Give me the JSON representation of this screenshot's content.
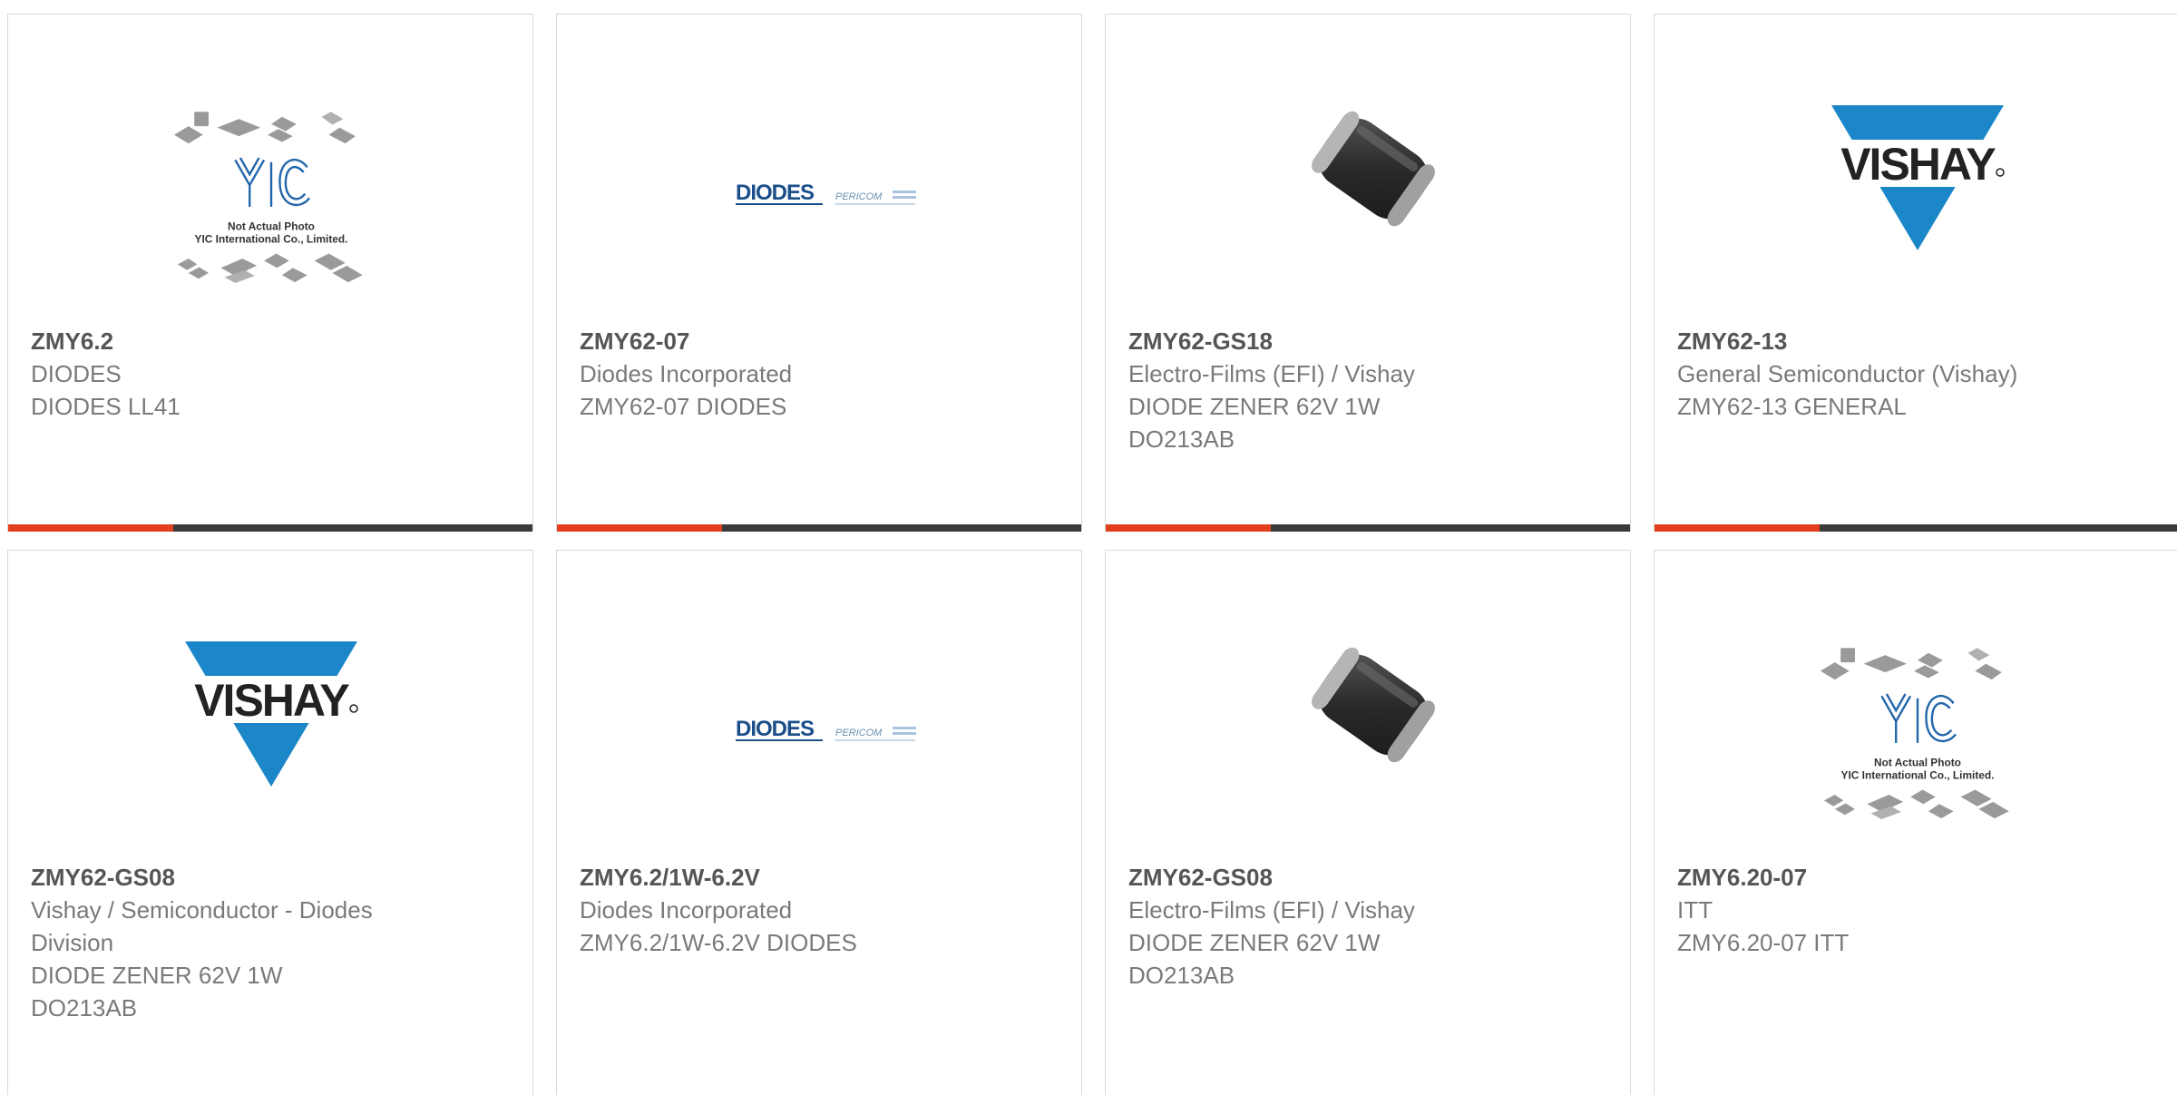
{
  "products": [
    {
      "part_number": "ZMY6.2",
      "manufacturer": "DIODES",
      "description": "DIODES LL41",
      "image": "yic-placeholder",
      "image_caption": [
        "Not Actual Photo",
        "YIC International Co., Limited."
      ]
    },
    {
      "part_number": "ZMY62-07",
      "manufacturer": "Diodes Incorporated",
      "description": "ZMY62-07 DIODES",
      "image": "diodes-logo",
      "logo_text": "DIODES",
      "logo_sub": "PERICOM"
    },
    {
      "part_number": "ZMY62-GS18",
      "manufacturer": "Electro-Films (EFI) / Vishay",
      "description": "DIODE ZENER 62V 1W DO213AB",
      "image": "diode-cylinder-photo"
    },
    {
      "part_number": "ZMY62-13",
      "manufacturer": "General Semiconductor (Vishay)",
      "description": "ZMY62-13 GENERAL",
      "image": "vishay-logo",
      "logo_text": "VISHAY"
    },
    {
      "part_number": "ZMY62-GS08",
      "manufacturer": "Vishay / Semiconductor - Diodes Division",
      "description": "DIODE ZENER 62V 1W DO213AB",
      "image": "vishay-logo",
      "logo_text": "VISHAY"
    },
    {
      "part_number": "ZMY6.2/1W-6.2V",
      "manufacturer": "Diodes Incorporated",
      "description": "ZMY6.2/1W-6.2V DIODES",
      "image": "diodes-logo",
      "logo_text": "DIODES",
      "logo_sub": "PERICOM"
    },
    {
      "part_number": "ZMY62-GS08",
      "manufacturer": "Electro-Films (EFI) / Vishay",
      "description": "DIODE ZENER 62V 1W DO213AB",
      "image": "diode-cylinder-photo"
    },
    {
      "part_number": "ZMY6.20-07",
      "manufacturer": "ITT",
      "description": "ZMY6.20-07 ITT",
      "image": "yic-placeholder",
      "image_caption": [
        "Not Actual Photo",
        "YIC International Co., Limited."
      ]
    }
  ],
  "colors": {
    "accent_orange": "#e2401c",
    "accent_dark": "#3a3a3a",
    "vishay_blue": "#1b87c9",
    "diodes_blue": "#1a4f8a",
    "text": "#7a7a7a"
  }
}
